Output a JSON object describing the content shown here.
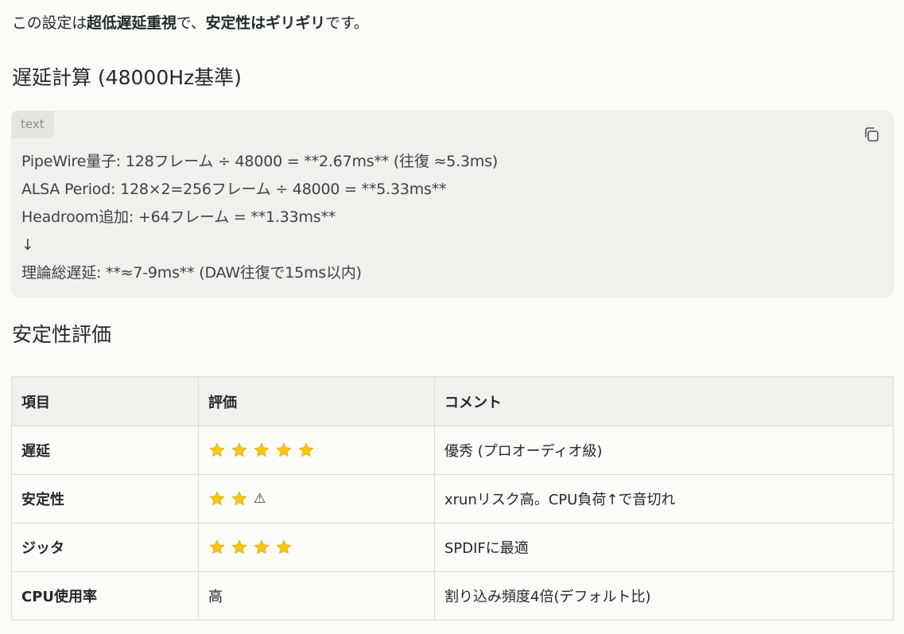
{
  "intro": {
    "p1": "この設定は",
    "b1": "超低遅延重視",
    "p2": "で、",
    "b2": "安定性はギリギリ",
    "p3": "です。"
  },
  "heading_latency": "遅延計算 (48000Hz基準)",
  "code": {
    "lang": "text",
    "copy_icon": "copy-icon",
    "lines": [
      "PipeWire量子: 128フレーム ÷ 48000 = **2.67ms** (往復 ≈5.3ms)",
      "ALSA Period: 128×2=256フレーム ÷ 48000 = **5.33ms**",
      "Headroom追加: +64フレーム = **1.33ms**",
      "↓",
      "理論総遅延: **≈7-9ms** (DAW往復で15ms以内)"
    ]
  },
  "heading_stability": "安定性評価",
  "table": {
    "headers": [
      "項目",
      "評価",
      "コメント"
    ],
    "rows": [
      {
        "item": "遅延",
        "rating_stars": 5,
        "rating_text": "",
        "warning": "",
        "comment": "優秀 (プロオーディオ級)"
      },
      {
        "item": "安定性",
        "rating_stars": 2,
        "rating_text": "",
        "warning": "⚠",
        "comment": "xrunリスク高。CPU負荷↑で音切れ"
      },
      {
        "item": "ジッタ",
        "rating_stars": 4,
        "rating_text": "",
        "warning": "",
        "comment": "SPDIFに最適"
      },
      {
        "item": "CPU使用率",
        "rating_stars": 0,
        "rating_text": "高",
        "warning": "",
        "comment": "割り込み頻度4倍(デフォルト比)"
      }
    ],
    "star_color": "#f5c518"
  }
}
